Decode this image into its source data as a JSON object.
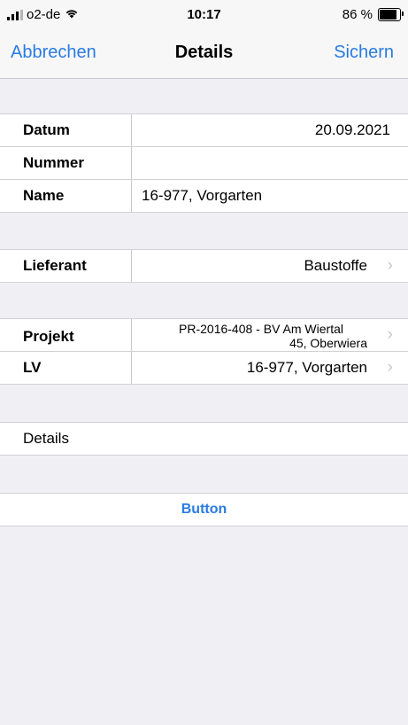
{
  "status": {
    "carrier": "o2-de",
    "time": "10:17",
    "battery": "86 %"
  },
  "nav": {
    "cancel": "Abbrechen",
    "title": "Details",
    "save": "Sichern"
  },
  "section1": {
    "date_label": "Datum",
    "date_value": "20.09.2021",
    "number_label": "Nummer",
    "number_value": "",
    "name_label": "Name",
    "name_value": "16-977, Vorgarten"
  },
  "section2": {
    "supplier_label": "Lieferant",
    "supplier_value": "Baustoffe"
  },
  "section3": {
    "project_label": "Projekt",
    "project_value_line1": "PR-2016-408 - BV Am Wiertal",
    "project_value_line2": "45, Oberwiera",
    "lv_label": "LV",
    "lv_value": "16-977, Vorgarten"
  },
  "section4": {
    "details_label": "Details"
  },
  "section5": {
    "button_label": "Button"
  }
}
